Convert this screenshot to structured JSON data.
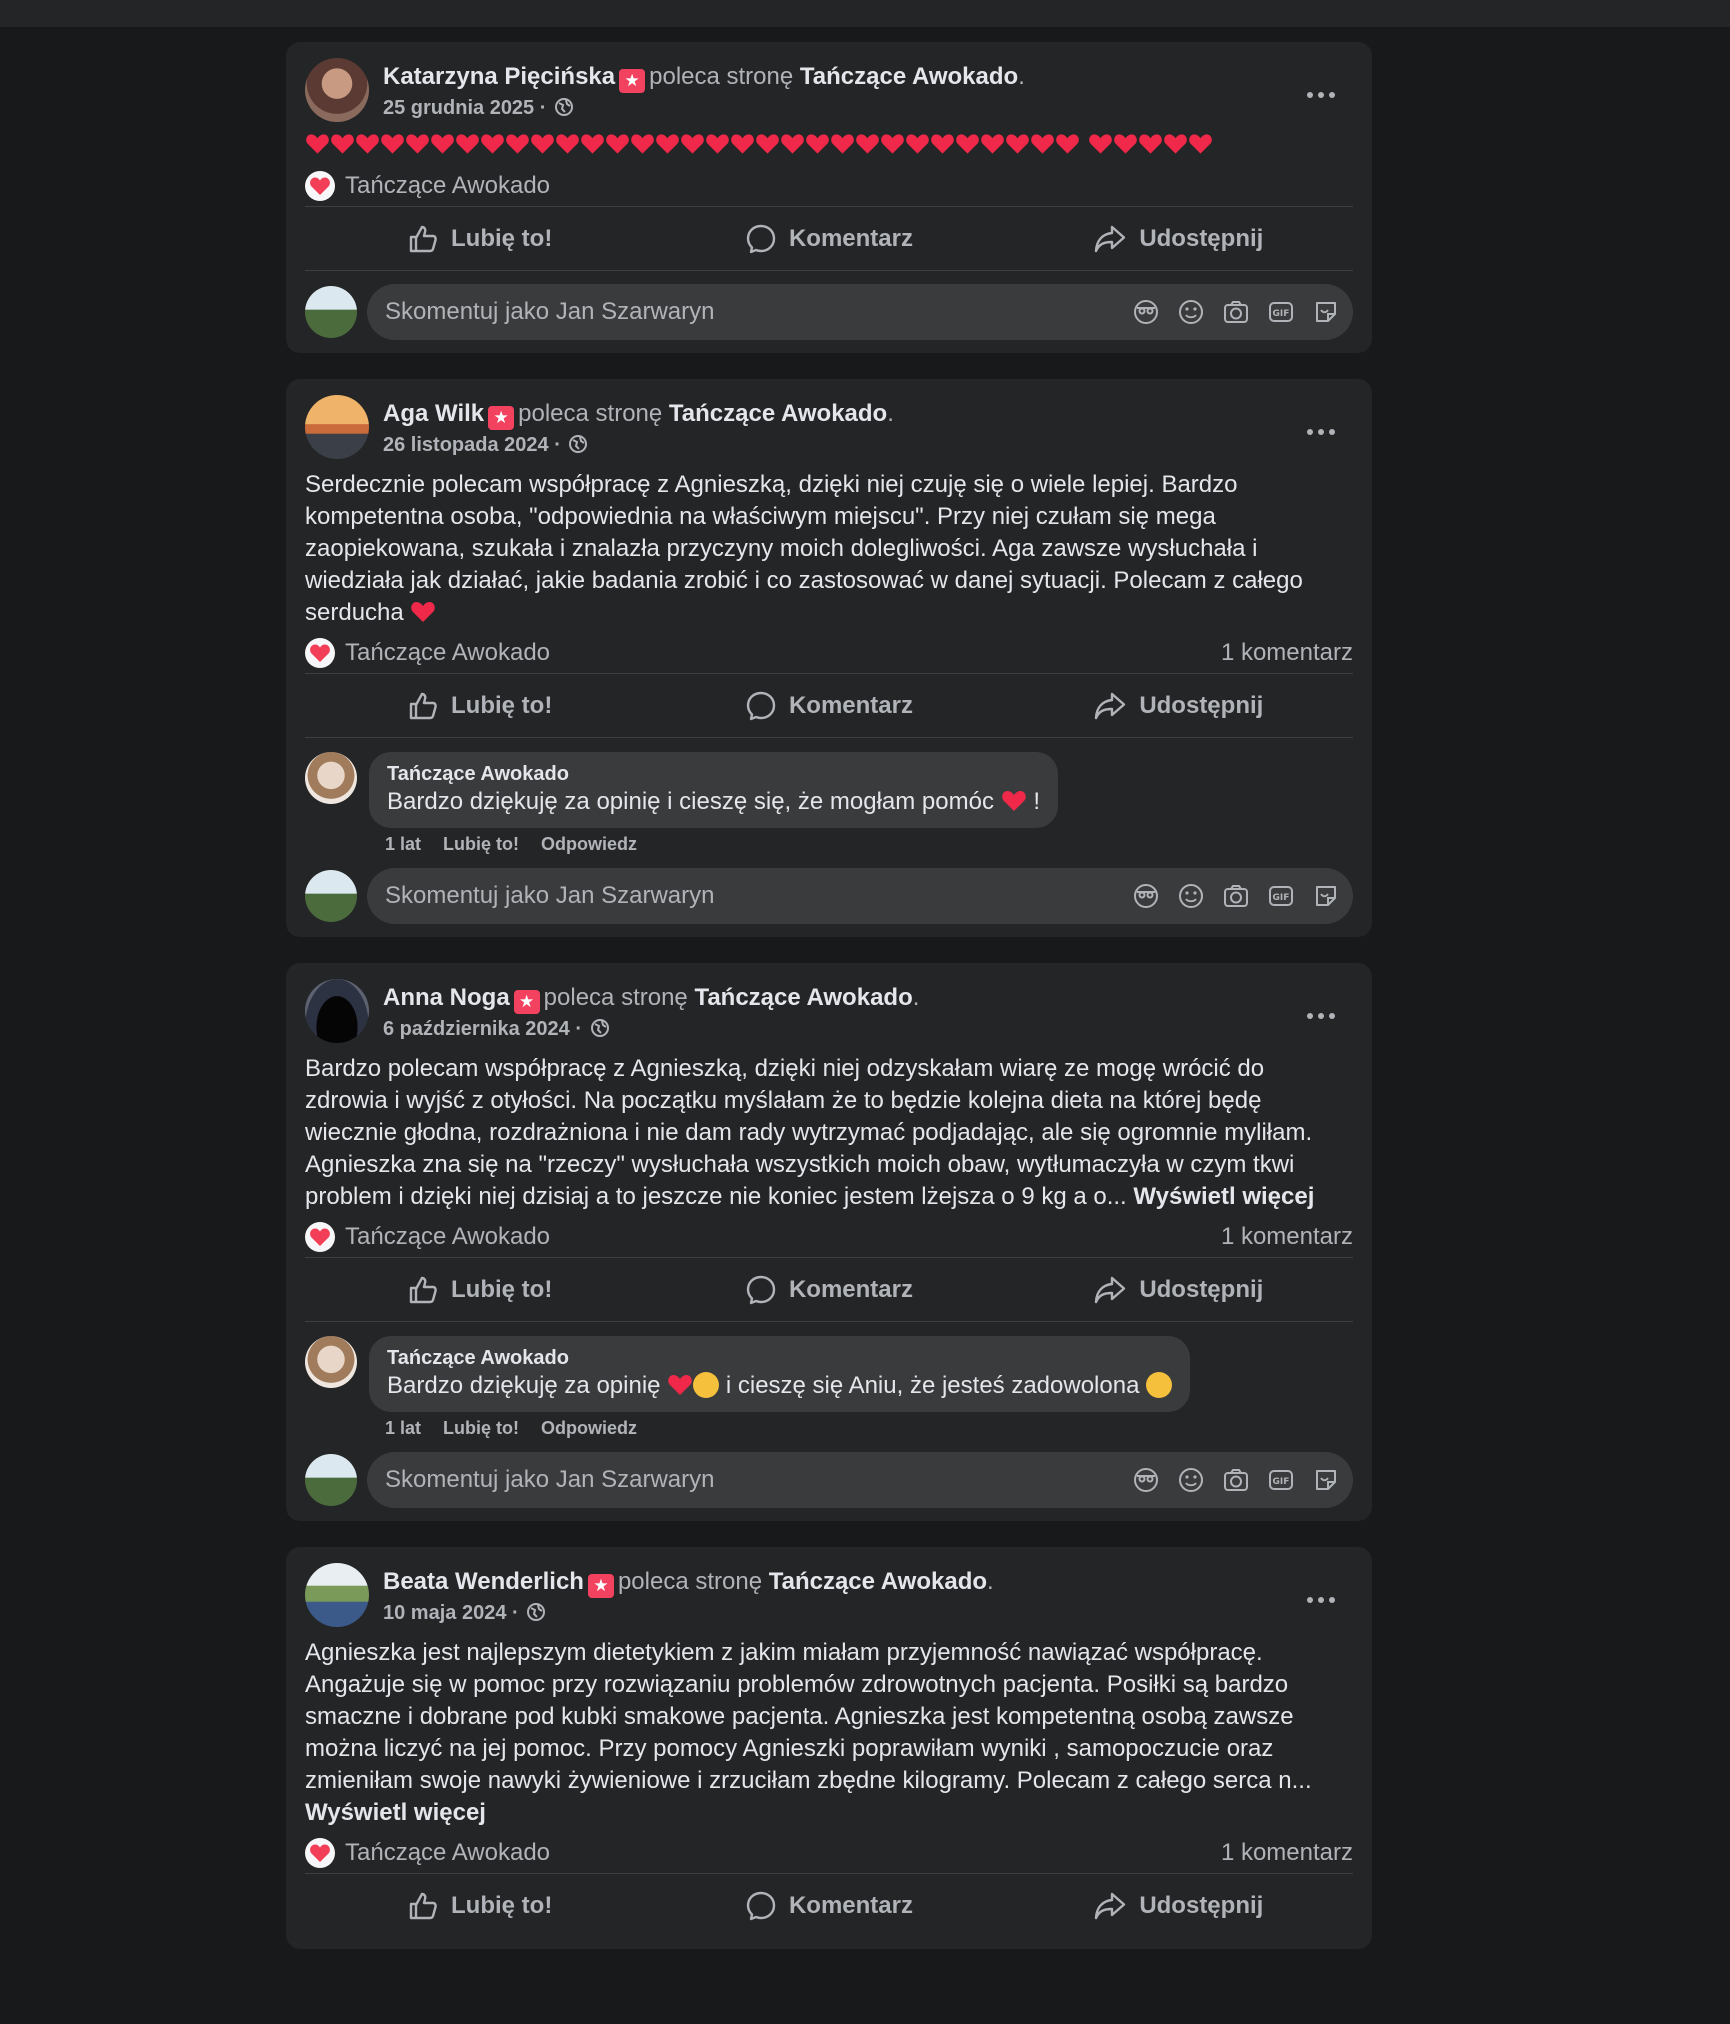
{
  "posts": [
    {
      "author": "Katarzyna Pięcińska",
      "recommends_text": "poleca stronę",
      "page": "Tańczące Awokado",
      "date": "25 grudnia 2025",
      "hearts_count": 36,
      "reaction_label": "Tańczące Awokado",
      "comments_count": "",
      "comments": []
    },
    {
      "author": "Aga Wilk",
      "recommends_text": "poleca stronę",
      "page": "Tańczące Awokado",
      "date": "26 listopada 2024",
      "text": "Serdecznie polecam współpracę z Agnieszką, dzięki niej czuję się o wiele lepiej. Bardzo kompetentna osoba,  \"odpowiednia na właściwym miejscu\". Przy niej czułam się mega zaopiekowana, szukała i znalazła przyczyny moich dolegliwości. Aga zawsze wysłuchała i wiedziała jak działać, jakie badania zrobić i co zastosować w danej sytuacji. Polecam z całego serducha",
      "reaction_label": "Tańczące Awokado",
      "comments_count": "1 komentarz",
      "comments": [
        {
          "author": "Tańczące Awokado",
          "text_a": "Bardzo dziękuję za opinię i cieszę się, że mogłam pomóc",
          "text_b": "!",
          "time": "1 lat",
          "like": "Lubię to!",
          "reply": "Odpowiedz"
        }
      ]
    },
    {
      "author": "Anna Noga",
      "recommends_text": "poleca stronę",
      "page": "Tańczące Awokado",
      "date": "6 października 2024",
      "text": "Bardzo polecam współpracę z Agnieszką, dzięki niej odzyskałam wiarę ze mogę wrócić do zdrowia i wyjść z otyłości. Na początku myślałam że to będzie kolejna dieta na której będę wiecznie głodna, rozdrażniona i nie dam rady wytrzymać podjadając, ale się ogromnie myliłam. Agnieszka zna się na \"rzeczy\" wysłuchała wszystkich moich obaw, wytłumaczyła w czym tkwi problem i dzięki niej dzisiaj a to jeszcze nie koniec jestem lżejsza o 9 kg a o...",
      "see_more": "Wyświetl więcej",
      "reaction_label": "Tańczące Awokado",
      "comments_count": "1 komentarz",
      "comments": [
        {
          "author": "Tańczące Awokado",
          "text_a": "Bardzo dziękuję za opinię",
          "text_b": "i cieszę się Aniu, że jesteś zadowolona",
          "time": "1 lat",
          "like": "Lubię to!",
          "reply": "Odpowiedz"
        }
      ]
    },
    {
      "author": "Beata Wenderlich",
      "recommends_text": "poleca stronę",
      "page": "Tańczące Awokado",
      "date": "10 maja 2024",
      "text": "Agnieszka jest najlepszym dietetykiem z jakim miałam  przyjemność nawiązać współpracę. Angażuje się w pomoc przy rozwiązaniu problemów zdrowotnych pacjenta. Posiłki są bardzo smaczne i dobrane pod kubki smakowe pacjenta. Agnieszka jest kompetentną osobą zawsze można liczyć na jej pomoc. Przy pomocy Agnieszki poprawiłam  wyniki , samopoczucie oraz zmieniłam  swoje nawyki żywieniowe i zrzuciłam zbędne kilogramy. Polecam z całego serca n...",
      "see_more": "Wyświetl więcej",
      "reaction_label": "Tańczące Awokado",
      "comments_count": "1 komentarz",
      "comments": []
    }
  ],
  "actions": {
    "like": "Lubię to!",
    "comment": "Komentarz",
    "share": "Udostępnij"
  },
  "writer": {
    "placeholder": "Skomentuj jako Jan Szarwaryn"
  },
  "icons": {
    "like": "thumbs-up-icon",
    "comment": "comment-bubble-icon",
    "share": "share-arrow-icon",
    "more": "more-options-icon",
    "globe": "globe-icon",
    "reaction": "heart-reaction-icon",
    "recommend": "recommend-badge-icon",
    "avatar_sticker": "avatar-sticker-icon",
    "emoji": "emoji-icon",
    "camera": "camera-icon",
    "gif": "gif-icon",
    "sticker": "sticker-icon"
  },
  "colors": {
    "background": "#18191a",
    "card": "#242526",
    "accent_red": "#f02849",
    "text_secondary": "#b0b3b8"
  }
}
